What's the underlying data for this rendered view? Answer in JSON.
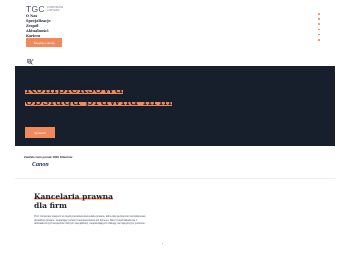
{
  "header": {
    "logo": {
      "mark": "TGC",
      "subtitle_line1": "Corporate",
      "subtitle_line2": "Lawyers"
    },
    "nav": [
      "O Nas",
      "Specjalizacje",
      "Zespół",
      "Aktualności",
      "Kariera",
      "Kontakt"
    ],
    "cta_label": "Zapytaj o ofertę",
    "search_icon": "search-icon",
    "language_icon": "flag-icon"
  },
  "hero": {
    "title_line1": "Kompleksowa",
    "title_line2": "obsługa prawna firm",
    "button_label": "Sprawdź"
  },
  "trusted": {
    "text": "Zaufało nam ponad 1000 Klientów",
    "client_logo": "Canon"
  },
  "section": {
    "title_line1": "Kancelaria prawna",
    "title_line2": "dla firm",
    "text": "TGC Corporate Lawyers to międzynarodowa kancelaria prawna, która oferuje klientom kompleksowe doradztwo prawne, wspierając rozwój i bezpieczeństwo ich biznesu. Nasz zespół składa się z doświadczonych ekspertów różnych specjalizacji, zapewniających obsługę na najwyższym poziomie."
  },
  "colors": {
    "accent": "#f08a5d",
    "navy": "#171e2c",
    "text": "#1f2330"
  }
}
